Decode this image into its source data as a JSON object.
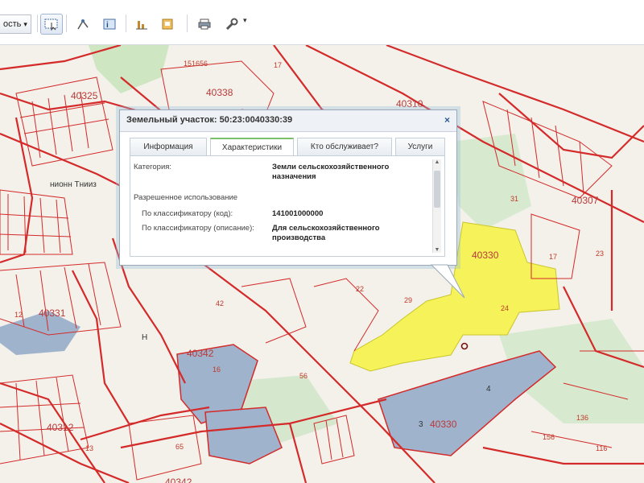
{
  "toolbar": {
    "layer_select": "ость",
    "caret": "▾",
    "tool_caret": "▾"
  },
  "popup": {
    "title": "Земельный участок: 50:23:0040330:39",
    "close": "×",
    "tabs": [
      {
        "label": "Информация"
      },
      {
        "label": "Характеристики"
      },
      {
        "label": "Кто обслуживает?"
      },
      {
        "label": "Услуги"
      }
    ],
    "fields": {
      "category_label": "Категория:",
      "category_value": "Земли сельскохозяйственного назначения",
      "permitted_use": "Разрешенное использование",
      "class_code_label": "По классификатору (код):",
      "class_code_value": "141001000000",
      "class_desc_label": "По классификатору (описание):",
      "class_desc_value": "Для сельскохозяйственного производства"
    }
  },
  "map": {
    "labels": {
      "l_151656": "151656",
      "l_40338": "40338",
      "l_40325": "40325",
      "l_40310": "40310",
      "l_40330": "40330",
      "l_40330b": "40330",
      "l_40342": "40342",
      "l_40342b": "40342",
      "l_40307": "40307",
      "l_40331": "40331",
      "l_40312": "40312",
      "l_tennis": "нионн Тнииз",
      "l_17a": "17",
      "l_17b": "17",
      "l_16": "16",
      "l_56": "56",
      "l_65": "65",
      "l_29": "29",
      "l_22": "22",
      "l_42": "42",
      "l_31": "31",
      "l_24": "24",
      "l_23": "23",
      "l_116": "116",
      "l_136": "136",
      "l_156": "156",
      "l_4": "4",
      "l_3": "3",
      "l_12": "12",
      "l_13": "13",
      "l_nn": "Н"
    },
    "colors": {
      "parcel_line": "#d42a2a",
      "selected_parcel": "#f6f35a",
      "blue_area": "#9fb3cc",
      "background": "#f3f1ea",
      "green": "#cfe6c3"
    }
  }
}
